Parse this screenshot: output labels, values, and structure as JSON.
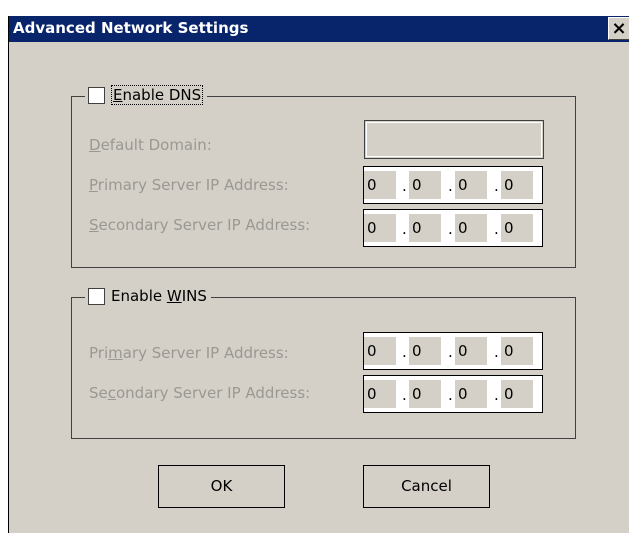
{
  "window": {
    "title": "Advanced Network Settings",
    "close_label": "×"
  },
  "dns": {
    "enable_label_first": "E",
    "enable_label_rest": "nable DNS",
    "default_domain": {
      "u": "D",
      "rest": "efault Domain:",
      "value": ""
    },
    "primary": {
      "u": "P",
      "rest": "rimary Server IP Address:",
      "octets": [
        "0",
        "0",
        "0",
        "0"
      ]
    },
    "secondary": {
      "u": "S",
      "rest": "econdary Server IP Address:",
      "octets": [
        "0",
        "0",
        "0",
        "0"
      ]
    }
  },
  "wins": {
    "enable_label_pre": "Enable ",
    "enable_label_u": "W",
    "enable_label_post": "INS",
    "primary": {
      "pre": "Pri",
      "u": "m",
      "post": "ary Server IP Address:",
      "octets": [
        "0",
        "0",
        "0",
        "0"
      ]
    },
    "secondary": {
      "pre": "Se",
      "u": "c",
      "post": "ondary Server IP Address:",
      "octets": [
        "0",
        "0",
        "0",
        "0"
      ]
    }
  },
  "buttons": {
    "ok": "OK",
    "cancel": "Cancel"
  },
  "ip_separator": "."
}
